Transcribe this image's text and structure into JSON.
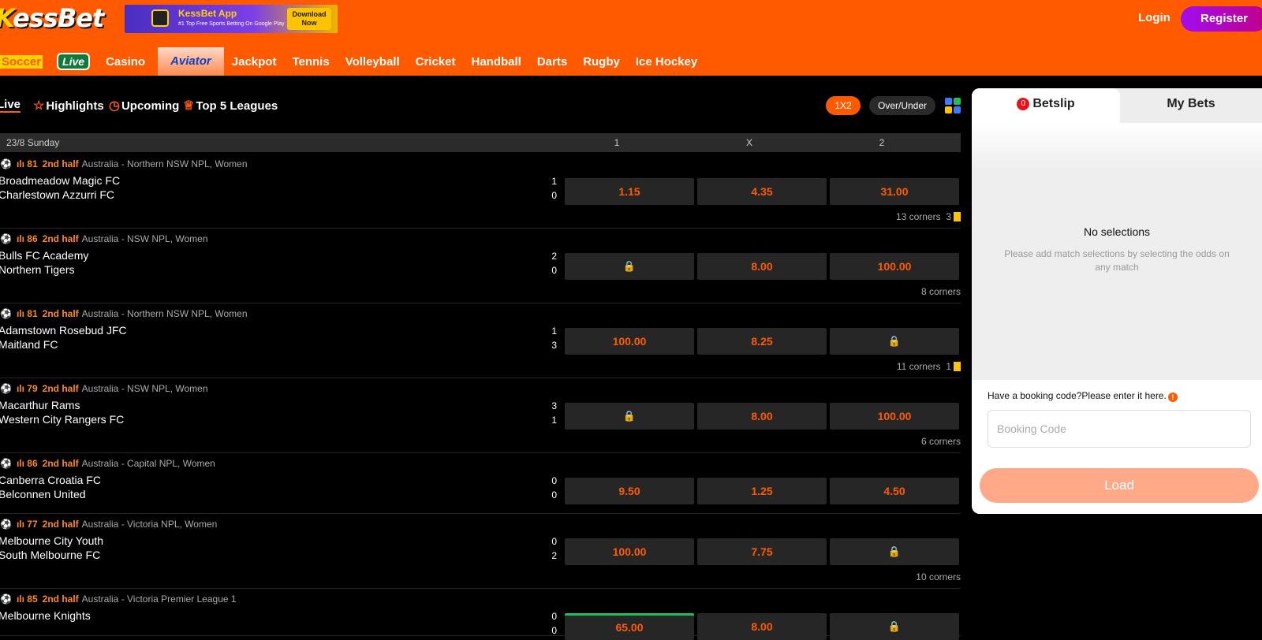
{
  "header": {
    "logo": {
      "first": "K",
      "rest": "essBet"
    },
    "banner": {
      "title": "KessBet App",
      "subtitle": "#1 Top Free Sports Betting On Google Play",
      "cta": "Download Now"
    },
    "login_label": "Login",
    "register_label": "Register",
    "accent": "#ff5a00"
  },
  "sports": [
    "Soccer",
    "Live",
    "Casino",
    "Aviator",
    "Jackpot",
    "Tennis",
    "Volleyball",
    "Cricket",
    "Handball",
    "Darts",
    "Rugby",
    "Ice Hockey"
  ],
  "filters": {
    "tabs": [
      "Live",
      "Highlights",
      "Upcoming",
      "Top 5 Leagues"
    ],
    "markets": [
      "1X2",
      "Over/Under"
    ]
  },
  "day_header": {
    "date": "23/8 Sunday",
    "col1": "1",
    "colx": "X",
    "col2": "2"
  },
  "matches": [
    {
      "minute": "81",
      "half": "2nd half",
      "league": "Australia - Northern NSW NPL, Women",
      "home": "Broadmeadow Magic FC",
      "away": "Charlestown Azzurri FC",
      "home_score": "1",
      "away_score": "0",
      "odd1": "1.15",
      "oddx": "4.35",
      "odd2": "31.00",
      "corners": "13 corners",
      "cards": "3"
    },
    {
      "minute": "86",
      "half": "2nd half",
      "league": "Australia - NSW NPL, Women",
      "home": "Bulls FC Academy",
      "away": "Northern Tigers",
      "home_score": "2",
      "away_score": "0",
      "odd1": "🔒",
      "oddx": "8.00",
      "odd2": "100.00",
      "corners": "8 corners",
      "cards": ""
    },
    {
      "minute": "81",
      "half": "2nd half",
      "league": "Australia - Northern NSW NPL, Women",
      "home": "Adamstown Rosebud JFC",
      "away": "Maitland FC",
      "home_score": "1",
      "away_score": "3",
      "odd1": "100.00",
      "oddx": "8.25",
      "odd2": "🔒",
      "corners": "11 corners",
      "cards": "1"
    },
    {
      "minute": "79",
      "half": "2nd half",
      "league": "Australia - NSW NPL, Women",
      "home": "Macarthur Rams",
      "away": "Western City Rangers FC",
      "home_score": "3",
      "away_score": "1",
      "odd1": "🔒",
      "oddx": "8.00",
      "odd2": "100.00",
      "corners": "6 corners",
      "cards": ""
    },
    {
      "minute": "86",
      "half": "2nd half",
      "league": "Australia - Capital NPL, Women",
      "home": "Canberra Croatia FC",
      "away": "Belconnen United",
      "home_score": "0",
      "away_score": "0",
      "odd1": "9.50",
      "oddx": "1.25",
      "odd2": "4.50",
      "corners": "",
      "cards": ""
    },
    {
      "minute": "77",
      "half": "2nd half",
      "league": "Australia - Victoria NPL, Women",
      "home": "Melbourne City Youth",
      "away": "South Melbourne FC",
      "home_score": "0",
      "away_score": "2",
      "odd1": "100.00",
      "oddx": "7.75",
      "odd2": "🔒",
      "corners": "10 corners",
      "cards": ""
    },
    {
      "minute": "85",
      "half": "2nd half",
      "league": "Australia - Victoria Premier League 1",
      "home": "Melbourne Knights",
      "away": "",
      "home_score": "0",
      "away_score": "0",
      "odd1": "65.00",
      "oddx": "8.00",
      "odd2": "🔒",
      "corners": "",
      "cards": ""
    }
  ],
  "betslip": {
    "count": "0",
    "tab_betslip": "Betslip",
    "tab_mybets": "My Bets",
    "empty_title": "No selections",
    "empty_sub": "Please add match selections by selecting the odds on any match",
    "booking_label": "Have a booking code?Please enter it here.",
    "booking_placeholder": "Booking Code",
    "load_label": "Load"
  }
}
